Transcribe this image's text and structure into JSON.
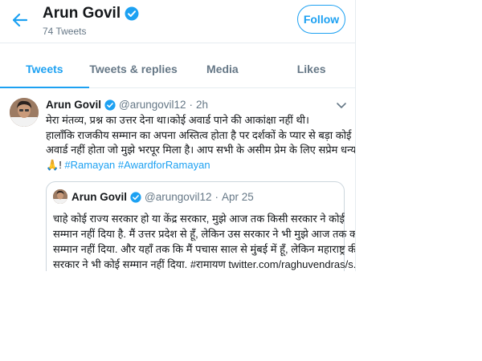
{
  "header": {
    "name": "Arun Govil",
    "tweet_count": "74 Tweets",
    "follow_label": "Follow"
  },
  "tabs": [
    {
      "label": "Tweets",
      "active": true
    },
    {
      "label": "Tweets & replies",
      "active": false
    },
    {
      "label": "Media",
      "active": false
    },
    {
      "label": "Likes",
      "active": false
    }
  ],
  "tweet": {
    "author": "Arun Govil",
    "handle": "@arungovil12",
    "separator": "·",
    "time": "2h",
    "lines": [
      "मेरा मंतव्य, प्रश्न का उत्तर देना था।कोई अवार्ड पाने की आकांक्षा नहीं थी।",
      "हालाँकि राजकीय सम्मान का अपना अस्तित्व होता है पर दर्शकों के प्यार से बड़ा कोई",
      "अवार्ड नहीं होता जो मुझे भरपूर मिला है। आप सभी के असीम प्रेम के लिए सप्रेम धन्यवाद"
    ],
    "emoji": "🙏",
    "last_line_prefix": "! ",
    "hashtags": "#Ramayan #AwardforRamayan"
  },
  "quoted": {
    "author": "Arun Govil",
    "handle": "@arungovil12",
    "separator": "·",
    "time": "Apr 25",
    "lines": [
      "चाहे कोई राज्य सरकार हो या केंद्र सरकार, मुझे आज तक किसी सरकार ने कोई",
      "सम्मान नहीं दिया है. मैं उत्तर प्रदेश से हूँ, लेकिन उस सरकार ने भी मुझे आज तक कोई",
      "सम्मान नहीं दिया. और यहाँ तक कि मैं पचास साल से मुंबई में हूँ, लेकिन महाराष्ट्र की",
      "सरकार ने भी कोई सम्मान नहीं दिया. #रामायण twitter.com/raghuvendras/s..."
    ]
  },
  "colors": {
    "accent": "#1da1f2",
    "muted": "#657786",
    "border": "#e6ecf0"
  }
}
